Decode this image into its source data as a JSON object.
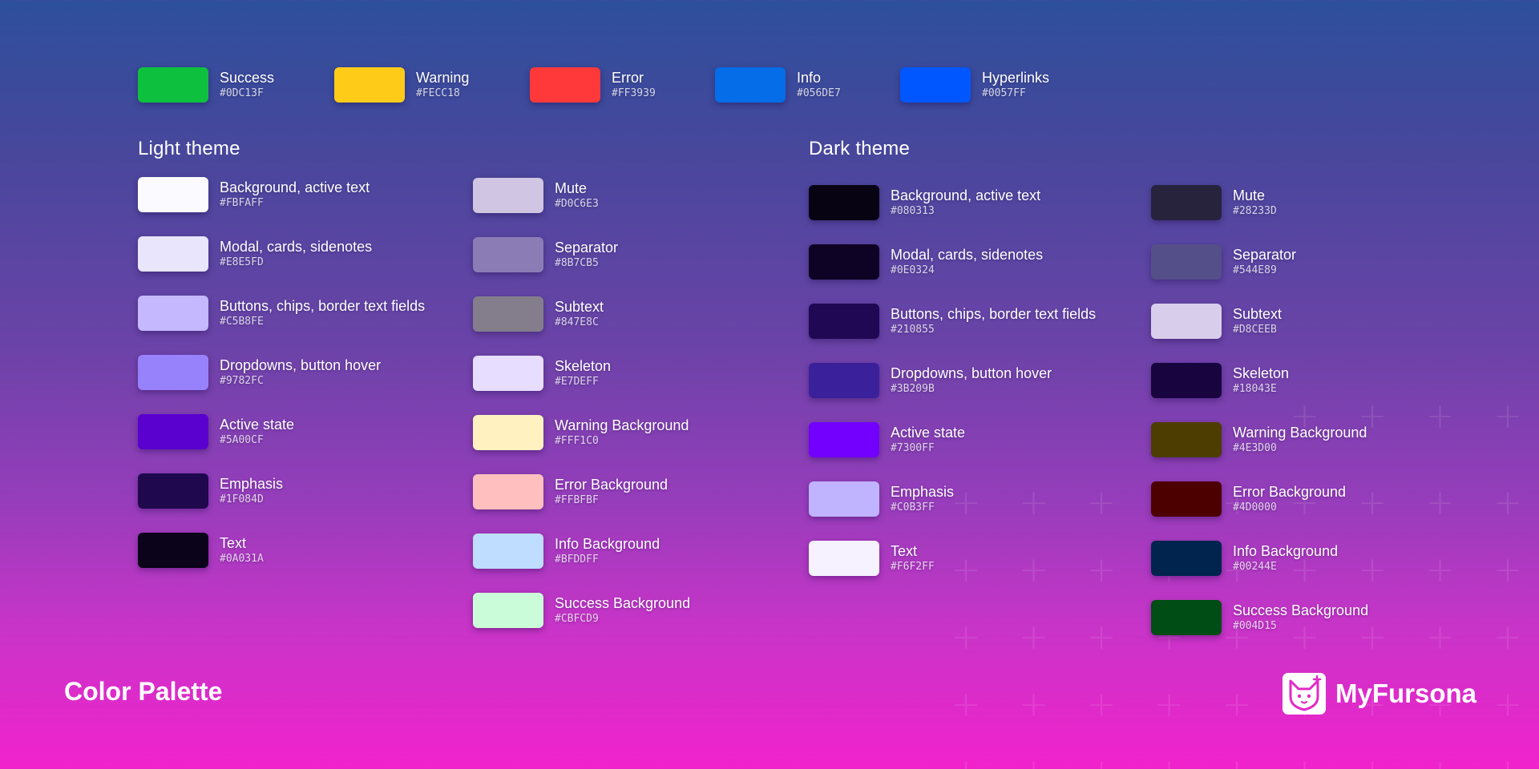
{
  "status_colors": [
    {
      "label": "Success",
      "hex": "#0DC13F"
    },
    {
      "label": "Warning",
      "hex": "#FECC18"
    },
    {
      "label": "Error",
      "hex": "#FF3939"
    },
    {
      "label": "Info",
      "hex": "#056DE7"
    },
    {
      "label": "Hyperlinks",
      "hex": "#0057FF"
    }
  ],
  "light_theme": {
    "title": "Light theme",
    "primary": [
      {
        "label": "Background, active text",
        "hex": "#FBFAFF"
      },
      {
        "label": "Modal, cards, sidenotes",
        "hex": "#E8E5FD"
      },
      {
        "label": "Buttons, chips, border text fields",
        "hex": "#C5B8FE"
      },
      {
        "label": "Dropdowns, button hover",
        "hex": "#9782FC"
      },
      {
        "label": "Active state",
        "hex": "#5A00CF"
      },
      {
        "label": "Emphasis",
        "hex": "#1F084D"
      },
      {
        "label": "Text",
        "hex": "#0A031A"
      }
    ],
    "secondary": [
      {
        "label": "Mute",
        "hex": "#D0C6E3"
      },
      {
        "label": "Separator",
        "hex": "#8B7CB5"
      },
      {
        "label": "Subtext",
        "hex": "#847E8C"
      },
      {
        "label": "Skeleton",
        "hex": "#E7DEFF"
      },
      {
        "label": "Warning Background",
        "hex": "#FFF1C0"
      },
      {
        "label": "Error Background",
        "hex": "#FFBFBF"
      },
      {
        "label": "Info Background",
        "hex": "#BFDDFF"
      },
      {
        "label": "Success Background",
        "hex": "#CBFCD9"
      }
    ]
  },
  "dark_theme": {
    "title": "Dark theme",
    "primary": [
      {
        "label": "Background, active text",
        "hex": "#080313"
      },
      {
        "label": "Modal, cards, sidenotes",
        "hex": "#0E0324"
      },
      {
        "label": "Buttons, chips, border text fields",
        "hex": "#210855"
      },
      {
        "label": "Dropdowns, button hover",
        "hex": "#3B209B"
      },
      {
        "label": "Active state",
        "hex": "#7300FF"
      },
      {
        "label": "Emphasis",
        "hex": "#C0B3FF"
      },
      {
        "label": "Text",
        "hex": "#F6F2FF"
      }
    ],
    "secondary": [
      {
        "label": "Mute",
        "hex": "#28233D"
      },
      {
        "label": "Separator",
        "hex": "#544E89"
      },
      {
        "label": "Subtext",
        "hex": "#D8CEEB"
      },
      {
        "label": "Skeleton",
        "hex": "#18043E"
      },
      {
        "label": "Warning Background",
        "hex": "#4E3D00"
      },
      {
        "label": "Error Background",
        "hex": "#4D0000"
      },
      {
        "label": "Info Background",
        "hex": "#00244E"
      },
      {
        "label": "Success Background",
        "hex": "#004D15"
      }
    ]
  },
  "footer": {
    "title": "Color Palette",
    "brand_name": "MyFursona",
    "brand_icon": "fox-logo-icon"
  },
  "colors": {
    "background_top": "#2d4f9c",
    "background_bottom": "#f122cc"
  }
}
